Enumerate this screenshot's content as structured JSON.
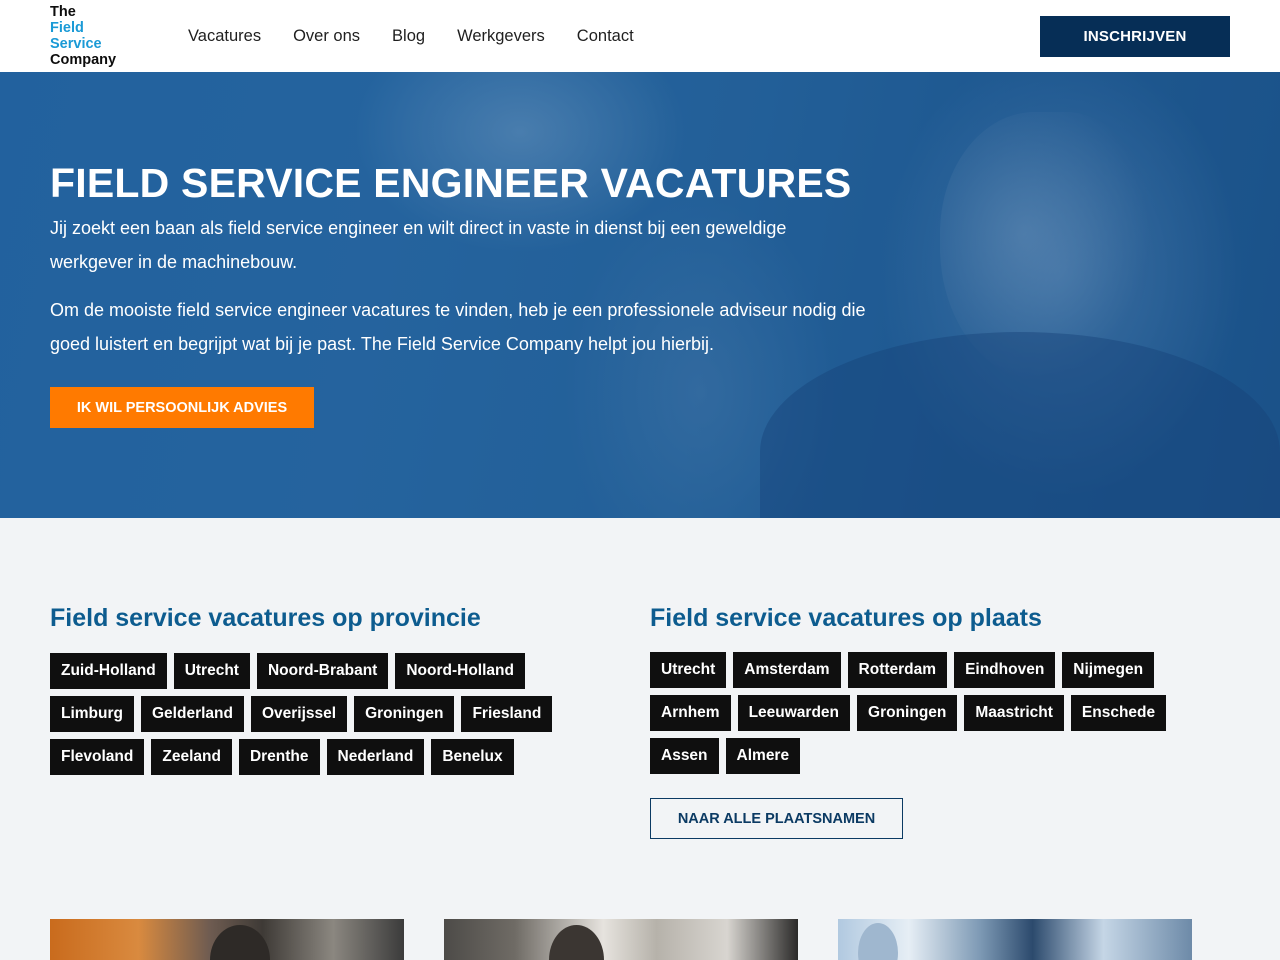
{
  "logo": {
    "line1": "The",
    "line2": "Field",
    "line3": "Service",
    "line4": "Company"
  },
  "nav": [
    "Vacatures",
    "Over ons",
    "Blog",
    "Werkgevers",
    "Contact"
  ],
  "header": {
    "signup_label": "INSCHRIJVEN"
  },
  "hero": {
    "title": "FIELD SERVICE ENGINEER VACATURES",
    "paragraph1": "Jij zoekt een baan als field service engineer en wilt direct in vaste in dienst bij een geweldige werkgever in de machinebouw.",
    "paragraph2": "Om de mooiste field service engineer vacatures te vinden, heb je een professionele adviseur nodig die goed luistert en begrijpt wat bij je past. The Field Service Company helpt jou hierbij.",
    "cta_label": "IK WIL PERSOONLIJK ADVIES"
  },
  "provincie": {
    "title": "Field service vacatures op provincie",
    "items": [
      "Zuid-Holland",
      "Utrecht",
      "Noord-Brabant",
      "Noord-Holland",
      "Limburg",
      "Gelderland",
      "Overijssel",
      "Groningen",
      "Friesland",
      "Flevoland",
      "Zeeland",
      "Drenthe",
      "Nederland",
      "Benelux"
    ]
  },
  "plaats": {
    "title": "Field service vacatures op plaats",
    "items": [
      "Utrecht",
      "Amsterdam",
      "Rotterdam",
      "Eindhoven",
      "Nijmegen",
      "Arnhem",
      "Leeuwarden",
      "Groningen",
      "Maastricht",
      "Enschede",
      "Assen",
      "Almere"
    ],
    "all_button_label": "NAAR ALLE PLAATSNAMEN"
  },
  "colors": {
    "brand_navy": "#062e56",
    "brand_blue": "#1a9ad6",
    "accent_orange": "#ff7a00",
    "section_title": "#0d5c8f"
  }
}
